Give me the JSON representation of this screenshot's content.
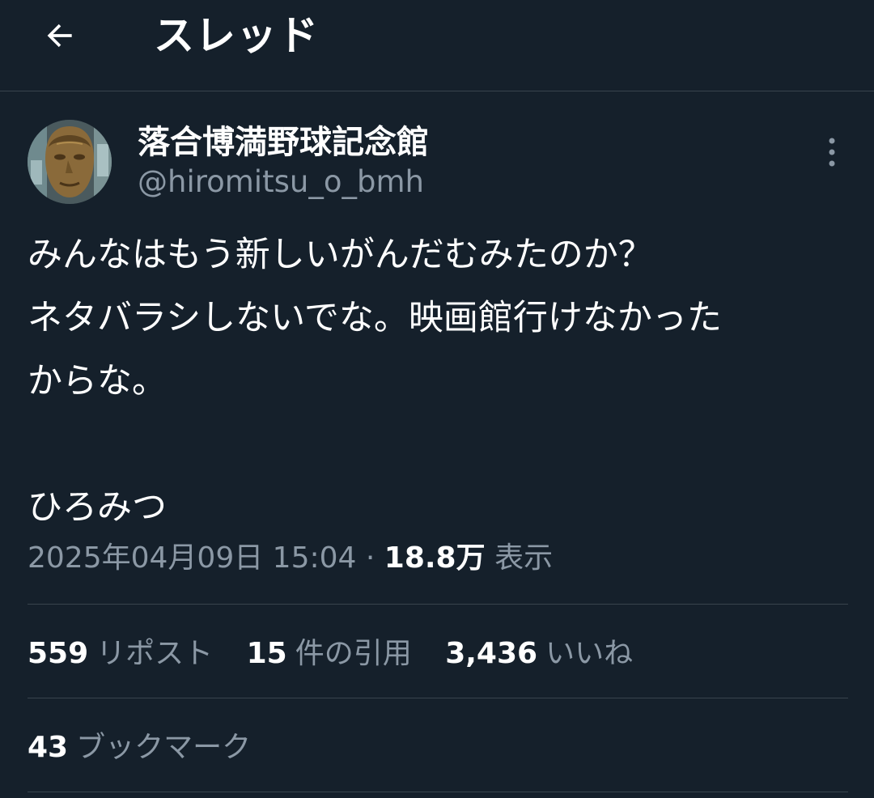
{
  "header": {
    "title": "スレッド",
    "back_icon": "back-arrow-icon"
  },
  "author": {
    "display_name": "落合博満野球記念館",
    "handle": "@hiromitsu_o_bmh",
    "more_icon": "more-vertical-icon"
  },
  "tweet": {
    "lines": [
      "みんなはもう新しいがんだむみたのか？",
      "ネタバラシしないでな。映画館行けなかった",
      "からな。",
      "",
      "ひろみつ"
    ]
  },
  "meta": {
    "datetime": "2025年04月09日 15:04",
    "separator": " · ",
    "views_count": "18.8万",
    "views_label": "表示"
  },
  "stats": {
    "reposts": {
      "count": "559",
      "label": "リポスト"
    },
    "quotes": {
      "count": "15",
      "label": "件の引用"
    },
    "likes": {
      "count": "3,436",
      "label": "いいね"
    },
    "bookmarks": {
      "count": "43",
      "label": "ブックマーク"
    }
  },
  "colors": {
    "background": "#15202b",
    "text_primary": "#ffffff",
    "text_secondary": "#8b98a5",
    "divider": "#38444d"
  }
}
